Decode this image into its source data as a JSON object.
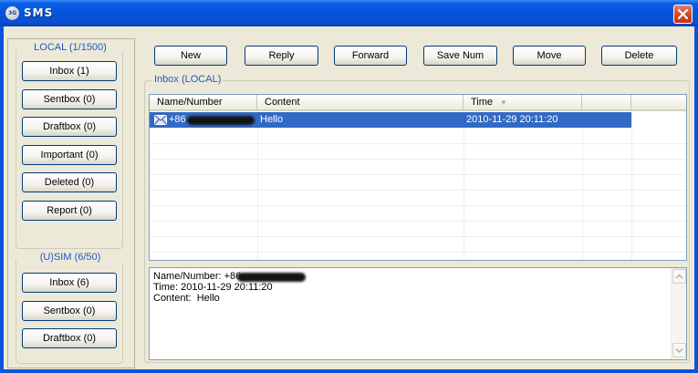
{
  "window": {
    "title": "SMS",
    "logo_text": "3G"
  },
  "local": {
    "heading": "LOCAL (1/1500)",
    "items": [
      "Inbox (1)",
      "Sentbox (0)",
      "Draftbox (0)",
      "Important (0)",
      "Deleted (0)",
      "Report (0)"
    ]
  },
  "sim": {
    "heading": "(U)SIM (6/50)",
    "items": [
      "Inbox (6)",
      "Sentbox (0)",
      "Draftbox (0)"
    ]
  },
  "toolbar": {
    "new": "New",
    "reply": "Reply",
    "forward": "Forward",
    "save_num": "Save Num",
    "move": "Move",
    "delete": "Delete"
  },
  "messages": {
    "group_label": "Inbox (LOCAL)",
    "columns": [
      "Name/Number",
      "Content",
      "Time"
    ],
    "rows": [
      {
        "number": "+86",
        "content": "Hello",
        "time": "2010-11-29 20:11:20"
      }
    ]
  },
  "detail": {
    "name_line": "Name/Number: +86",
    "time_line": "Time: 2010-11-29 20:11:20",
    "content_line": "Content:  Hello"
  },
  "colors": {
    "selection": "#316ac5",
    "title_bar": "#0553d9",
    "group_label": "#2257c5",
    "background": "#ece9d8"
  },
  "icons": {
    "row_icon": "envelope-icon",
    "close": "close-icon",
    "sort": "sort-down-icon"
  }
}
